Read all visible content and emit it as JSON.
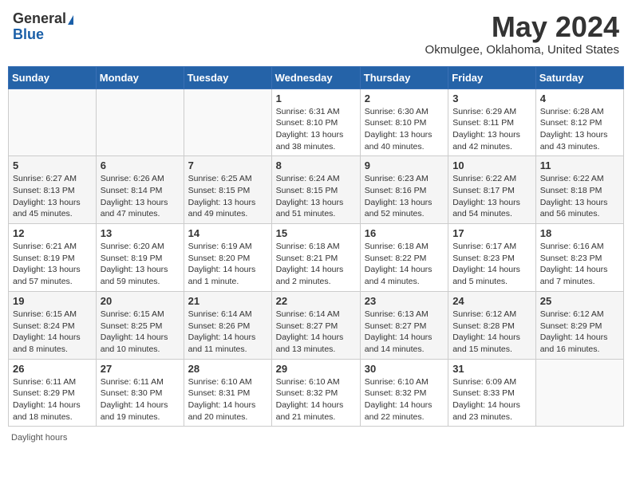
{
  "header": {
    "logo_general": "General",
    "logo_blue": "Blue",
    "month_title": "May 2024",
    "location": "Okmulgee, Oklahoma, United States"
  },
  "days_of_week": [
    "Sunday",
    "Monday",
    "Tuesday",
    "Wednesday",
    "Thursday",
    "Friday",
    "Saturday"
  ],
  "weeks": [
    [
      {
        "day": "",
        "info": ""
      },
      {
        "day": "",
        "info": ""
      },
      {
        "day": "",
        "info": ""
      },
      {
        "day": "1",
        "info": "Sunrise: 6:31 AM\nSunset: 8:10 PM\nDaylight: 13 hours\nand 38 minutes."
      },
      {
        "day": "2",
        "info": "Sunrise: 6:30 AM\nSunset: 8:10 PM\nDaylight: 13 hours\nand 40 minutes."
      },
      {
        "day": "3",
        "info": "Sunrise: 6:29 AM\nSunset: 8:11 PM\nDaylight: 13 hours\nand 42 minutes."
      },
      {
        "day": "4",
        "info": "Sunrise: 6:28 AM\nSunset: 8:12 PM\nDaylight: 13 hours\nand 43 minutes."
      }
    ],
    [
      {
        "day": "5",
        "info": "Sunrise: 6:27 AM\nSunset: 8:13 PM\nDaylight: 13 hours\nand 45 minutes."
      },
      {
        "day": "6",
        "info": "Sunrise: 6:26 AM\nSunset: 8:14 PM\nDaylight: 13 hours\nand 47 minutes."
      },
      {
        "day": "7",
        "info": "Sunrise: 6:25 AM\nSunset: 8:15 PM\nDaylight: 13 hours\nand 49 minutes."
      },
      {
        "day": "8",
        "info": "Sunrise: 6:24 AM\nSunset: 8:15 PM\nDaylight: 13 hours\nand 51 minutes."
      },
      {
        "day": "9",
        "info": "Sunrise: 6:23 AM\nSunset: 8:16 PM\nDaylight: 13 hours\nand 52 minutes."
      },
      {
        "day": "10",
        "info": "Sunrise: 6:22 AM\nSunset: 8:17 PM\nDaylight: 13 hours\nand 54 minutes."
      },
      {
        "day": "11",
        "info": "Sunrise: 6:22 AM\nSunset: 8:18 PM\nDaylight: 13 hours\nand 56 minutes."
      }
    ],
    [
      {
        "day": "12",
        "info": "Sunrise: 6:21 AM\nSunset: 8:19 PM\nDaylight: 13 hours\nand 57 minutes."
      },
      {
        "day": "13",
        "info": "Sunrise: 6:20 AM\nSunset: 8:19 PM\nDaylight: 13 hours\nand 59 minutes."
      },
      {
        "day": "14",
        "info": "Sunrise: 6:19 AM\nSunset: 8:20 PM\nDaylight: 14 hours\nand 1 minute."
      },
      {
        "day": "15",
        "info": "Sunrise: 6:18 AM\nSunset: 8:21 PM\nDaylight: 14 hours\nand 2 minutes."
      },
      {
        "day": "16",
        "info": "Sunrise: 6:18 AM\nSunset: 8:22 PM\nDaylight: 14 hours\nand 4 minutes."
      },
      {
        "day": "17",
        "info": "Sunrise: 6:17 AM\nSunset: 8:23 PM\nDaylight: 14 hours\nand 5 minutes."
      },
      {
        "day": "18",
        "info": "Sunrise: 6:16 AM\nSunset: 8:23 PM\nDaylight: 14 hours\nand 7 minutes."
      }
    ],
    [
      {
        "day": "19",
        "info": "Sunrise: 6:15 AM\nSunset: 8:24 PM\nDaylight: 14 hours\nand 8 minutes."
      },
      {
        "day": "20",
        "info": "Sunrise: 6:15 AM\nSunset: 8:25 PM\nDaylight: 14 hours\nand 10 minutes."
      },
      {
        "day": "21",
        "info": "Sunrise: 6:14 AM\nSunset: 8:26 PM\nDaylight: 14 hours\nand 11 minutes."
      },
      {
        "day": "22",
        "info": "Sunrise: 6:14 AM\nSunset: 8:27 PM\nDaylight: 14 hours\nand 13 minutes."
      },
      {
        "day": "23",
        "info": "Sunrise: 6:13 AM\nSunset: 8:27 PM\nDaylight: 14 hours\nand 14 minutes."
      },
      {
        "day": "24",
        "info": "Sunrise: 6:12 AM\nSunset: 8:28 PM\nDaylight: 14 hours\nand 15 minutes."
      },
      {
        "day": "25",
        "info": "Sunrise: 6:12 AM\nSunset: 8:29 PM\nDaylight: 14 hours\nand 16 minutes."
      }
    ],
    [
      {
        "day": "26",
        "info": "Sunrise: 6:11 AM\nSunset: 8:29 PM\nDaylight: 14 hours\nand 18 minutes."
      },
      {
        "day": "27",
        "info": "Sunrise: 6:11 AM\nSunset: 8:30 PM\nDaylight: 14 hours\nand 19 minutes."
      },
      {
        "day": "28",
        "info": "Sunrise: 6:10 AM\nSunset: 8:31 PM\nDaylight: 14 hours\nand 20 minutes."
      },
      {
        "day": "29",
        "info": "Sunrise: 6:10 AM\nSunset: 8:32 PM\nDaylight: 14 hours\nand 21 minutes."
      },
      {
        "day": "30",
        "info": "Sunrise: 6:10 AM\nSunset: 8:32 PM\nDaylight: 14 hours\nand 22 minutes."
      },
      {
        "day": "31",
        "info": "Sunrise: 6:09 AM\nSunset: 8:33 PM\nDaylight: 14 hours\nand 23 minutes."
      },
      {
        "day": "",
        "info": ""
      }
    ]
  ],
  "footer": {
    "daylight_label": "Daylight hours"
  }
}
